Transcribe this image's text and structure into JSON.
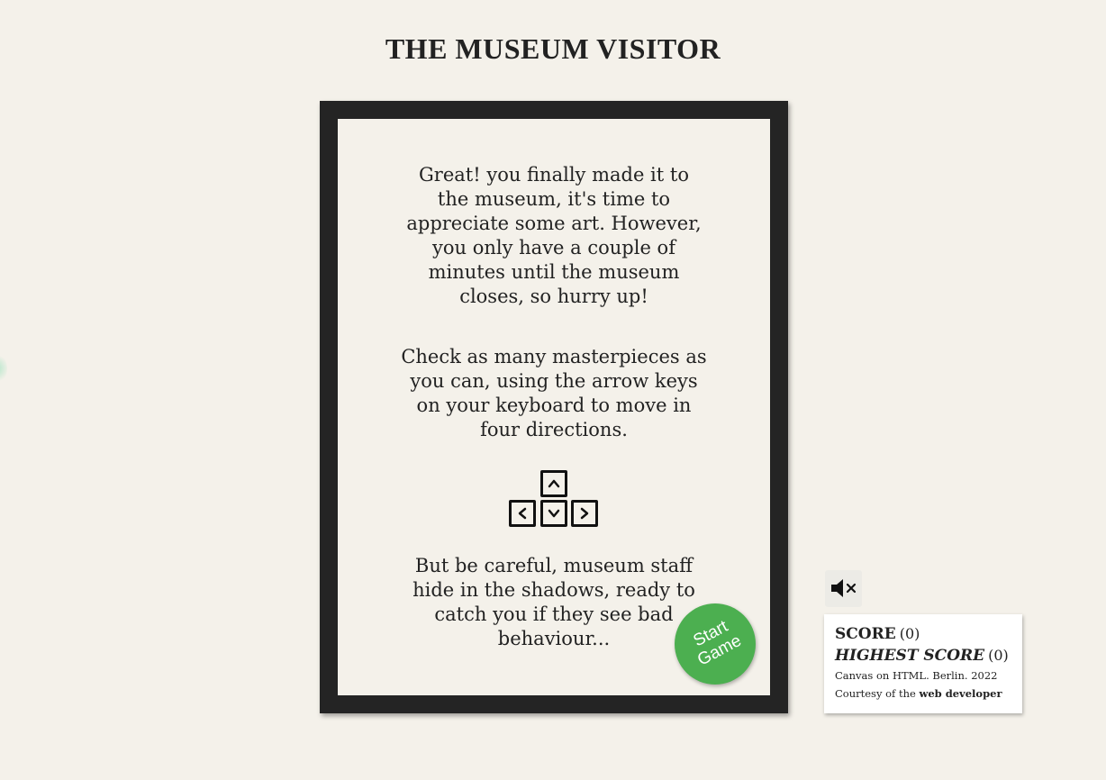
{
  "title": "THE MUSEUM VISITOR",
  "intro": {
    "paragraph1": "Great! you finally made it to the museum, it's time to appreciate some art. However, you only have a couple of minutes until the museum closes, so hurry up!",
    "paragraph2": "Check as many masterpieces as you can, using the arrow keys on your keyboard to move in four directions.",
    "paragraph3": "But be careful, museum staff hide in the shadows, ready to catch you if they see bad behaviour...",
    "keys_icon": [
      "arrow-up-key-icon",
      "arrow-left-key-icon",
      "arrow-down-key-icon",
      "arrow-right-key-icon"
    ]
  },
  "start_button": {
    "line1": "Start",
    "line2": "Game",
    "color": "#4caf50"
  },
  "sound": {
    "icon": "speaker-muted-icon"
  },
  "scoreboard": {
    "score_label": "SCORE",
    "score_value": "(0)",
    "highest_label": "HIGHEST SCORE",
    "highest_value": "(0)",
    "credit_line": "Canvas on HTML. Berlin. 2022",
    "courtesy_prefix": "Courtesy of the",
    "courtesy_link": "web developer"
  },
  "colors": {
    "background": "#f4f1ea",
    "frame": "#242424",
    "accent": "#4caf50"
  }
}
